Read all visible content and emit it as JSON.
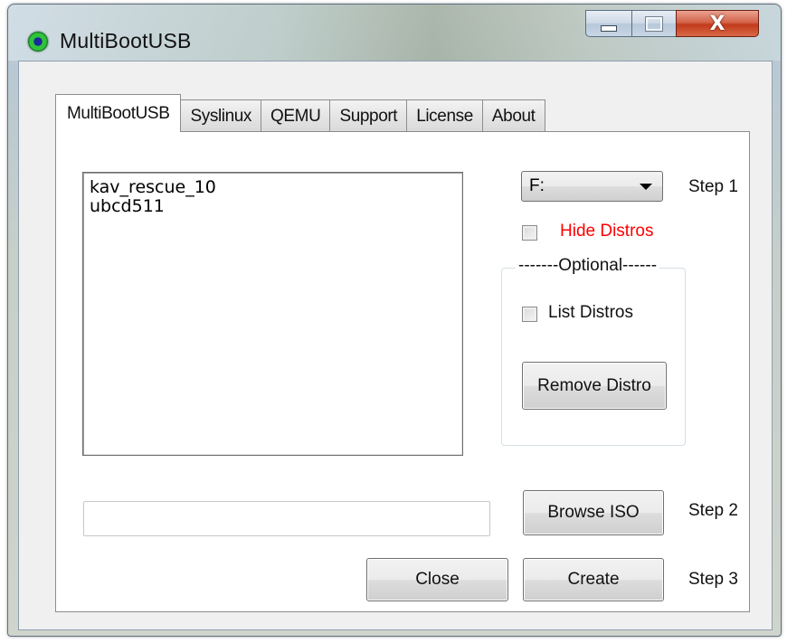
{
  "window": {
    "title": "MultiBootUSB",
    "minimize_icon": "minimize-icon",
    "maximize_icon": "maximize-icon",
    "close_icon": "close-icon",
    "close_glyph": "X"
  },
  "tabs": [
    {
      "label": "MultiBootUSB",
      "active": true
    },
    {
      "label": "Syslinux",
      "active": false
    },
    {
      "label": "QEMU",
      "active": false
    },
    {
      "label": "Support",
      "active": false
    },
    {
      "label": "License",
      "active": false
    },
    {
      "label": "About",
      "active": false
    }
  ],
  "distro_list": {
    "items": [
      "kav_rescue_10",
      "ubcd511"
    ]
  },
  "drive_select": {
    "selected": "F:"
  },
  "steps": {
    "step1": "Step 1",
    "step2": "Step 2",
    "step3": "Step 3"
  },
  "hide_distros": {
    "label": "Hide Distros",
    "checked": false,
    "color": "#ff0000"
  },
  "optional_group": {
    "legend": "-------Optional------",
    "list_distros_label": "List Distros",
    "list_distros_checked": false,
    "remove_button": "Remove Distro"
  },
  "iso_path": {
    "value": ""
  },
  "buttons": {
    "browse": "Browse ISO",
    "close": "Close",
    "create": "Create"
  }
}
